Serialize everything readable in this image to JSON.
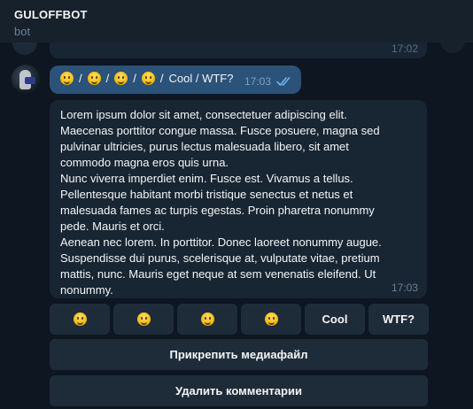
{
  "header": {
    "title": "GULOFFBOT",
    "subtitle": "bot"
  },
  "previous_message": {
    "time": "17:02"
  },
  "message1": {
    "emojis": [
      "grinning-face",
      "grinning-face",
      "grinning-squinting-face",
      "grinning-face-with-sweat"
    ],
    "separator": "/",
    "text_tail": "Cool / WTF?",
    "time": "17:03",
    "status_icon": "double-check-icon"
  },
  "message2": {
    "lines": [
      "Lorem ipsum dolor sit amet, consectetuer adipiscing elit.",
      "Maecenas porttitor congue massa. Fusce posuere, magna sed",
      "pulvinar ultricies, purus lectus malesuada libero, sit amet",
      "commodo magna eros quis urna.",
      "Nunc viverra imperdiet enim. Fusce est. Vivamus a tellus.",
      "Pellentesque habitant morbi tristique senectus et netus et",
      "malesuada fames ac turpis egestas. Proin pharetra nonummy",
      "pede. Mauris et orci.",
      "Aenean nec lorem. In porttitor. Donec laoreet nonummy augue.",
      "Suspendisse dui purus, scelerisque at, vulputate vitae, pretium",
      "mattis, nunc. Mauris eget neque at sem venenatis eleifend. Ut",
      "nonummy."
    ],
    "time": "17:03"
  },
  "keyboard": {
    "row1": {
      "emoji_buttons": [
        "grinning-face",
        "grinning-face",
        "grinning-squinting-face",
        "grinning-face-with-sweat"
      ],
      "cool_label": "Cool",
      "wtf_label": "WTF?"
    },
    "attach_label": "Прикрепить медиафайл",
    "delete_label": "Удалить комментарии"
  },
  "colors": {
    "background": "#0e1621",
    "header": "#17212b",
    "outgoing_bubble": "#2b5278",
    "incoming_bubble": "#182533",
    "keyboard_button": "#1e2c3a"
  }
}
